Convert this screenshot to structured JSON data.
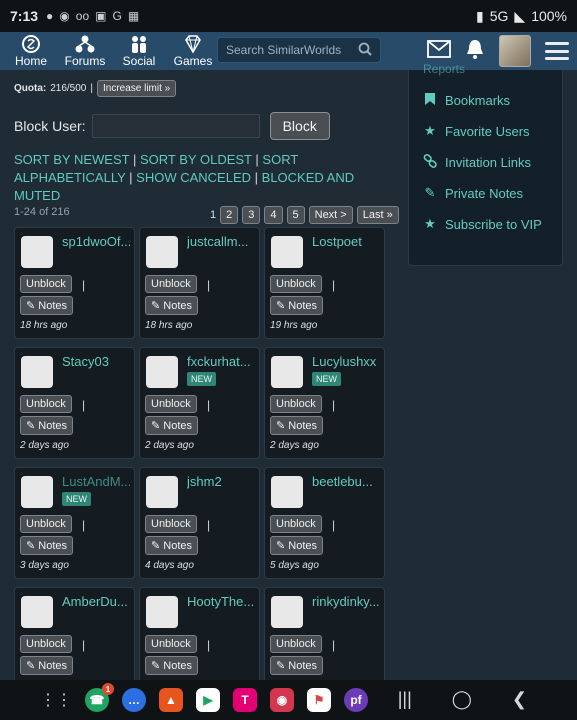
{
  "status_bar": {
    "time": "7:13",
    "network": "5G",
    "battery": "100%"
  },
  "nav": {
    "items": [
      {
        "label": "Home",
        "icon": "home-icon"
      },
      {
        "label": "Forums",
        "icon": "forums-icon"
      },
      {
        "label": "Social",
        "icon": "social-icon"
      },
      {
        "label": "Games",
        "icon": "games-icon"
      }
    ],
    "search_placeholder": "Search SimilarWorlds"
  },
  "quota": {
    "label": "Quota:",
    "value": "216/500",
    "sep": "|",
    "increase_label": "Increase limit »"
  },
  "block": {
    "label": "Block User:",
    "input_value": "",
    "button_label": "Block"
  },
  "sort_links": {
    "newest": "SORT BY NEWEST",
    "oldest": "SORT BY OLDEST",
    "alpha": "SORT ALPHABETICALLY",
    "canceled": "SHOW CANCELED",
    "blocked_muted": "BLOCKED AND MUTED",
    "sep": "|"
  },
  "range": "1-24 of 216",
  "pager": {
    "pages": [
      "1",
      "2",
      "3",
      "4",
      "5"
    ],
    "next": "Next >",
    "last": "Last »"
  },
  "card_buttons": {
    "unblock": "Unblock",
    "notes": "Notes",
    "pipe": "|",
    "new_badge": "NEW"
  },
  "cards": [
    {
      "name": "sp1dwoOf...",
      "ago": "18 hrs ago",
      "new": false,
      "dim": false
    },
    {
      "name": "justcallm...",
      "ago": "18 hrs ago",
      "new": false,
      "dim": false
    },
    {
      "name": "Lostpoet",
      "ago": "19 hrs ago",
      "new": false,
      "dim": false
    },
    {
      "name": "Stacy03",
      "ago": "2 days ago",
      "new": false,
      "dim": false
    },
    {
      "name": "fxckurhat...",
      "ago": "2 days ago",
      "new": true,
      "dim": false
    },
    {
      "name": "Lucylushxx",
      "ago": "2 days ago",
      "new": true,
      "dim": false
    },
    {
      "name": "LustAndM...",
      "ago": "3 days ago",
      "new": true,
      "dim": true
    },
    {
      "name": "jshm2",
      "ago": "4 days ago",
      "new": false,
      "dim": false
    },
    {
      "name": "beetlebu...",
      "ago": "5 days ago",
      "new": false,
      "dim": false
    },
    {
      "name": "AmberDu...",
      "ago": "",
      "new": false,
      "dim": false
    },
    {
      "name": "HootyThe...",
      "ago": "",
      "new": false,
      "dim": false
    },
    {
      "name": "rinkydinky...",
      "ago": "",
      "new": false,
      "dim": false
    }
  ],
  "side_panel": {
    "header": "Reports",
    "items": [
      {
        "label": "Bookmarks",
        "icon": "bookmark-icon"
      },
      {
        "label": "Favorite Users",
        "icon": "star-icon"
      },
      {
        "label": "Invitation Links",
        "icon": "link-icon"
      },
      {
        "label": "Private Notes",
        "icon": "edit-icon"
      },
      {
        "label": "Subscribe to VIP",
        "icon": "star-icon"
      }
    ]
  },
  "dock": {
    "phone_badge": "1",
    "tmobile_label": "T"
  },
  "colors": {
    "accent": "#62cbc1",
    "nav_bg": "#274b69",
    "page_bg": "#1f2b35",
    "card_bg": "#141b21"
  }
}
